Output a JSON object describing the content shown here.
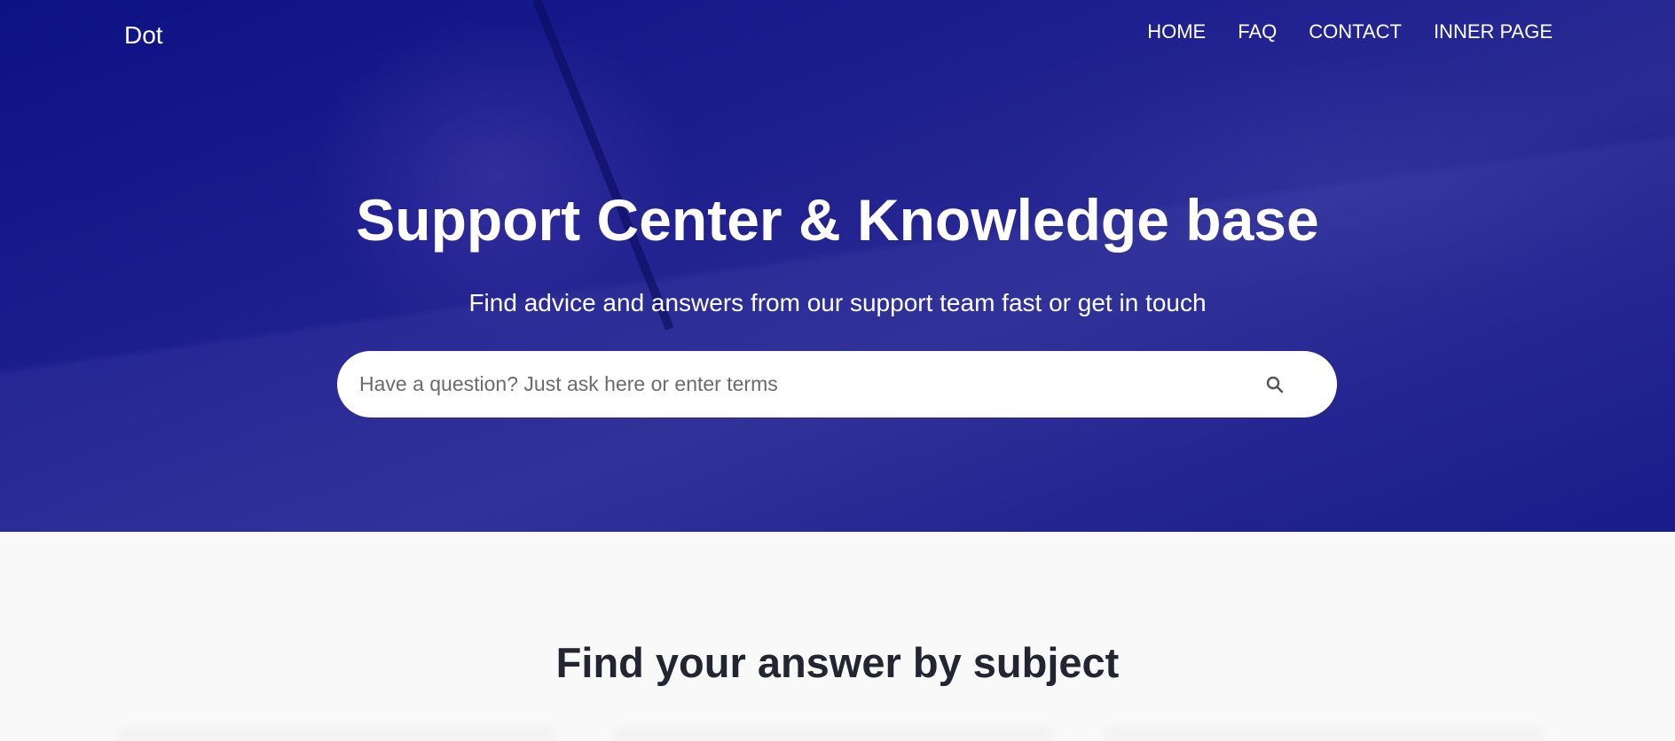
{
  "header": {
    "logo": "Dot",
    "nav": [
      "HOME",
      "FAQ",
      "CONTACT",
      "INNER PAGE"
    ]
  },
  "hero": {
    "title": "Support Center & Knowledge base",
    "subtitle": "Find advice and answers from our support team fast or get in touch",
    "search": {
      "placeholder": "Have a question? Just ask here or enter terms",
      "value": "",
      "icon": "search-icon"
    }
  },
  "section": {
    "heading": "Find your answer by subject"
  },
  "colors": {
    "hero": "#1d1e8e",
    "heading": "#232531",
    "background": "#f9f9f9"
  }
}
